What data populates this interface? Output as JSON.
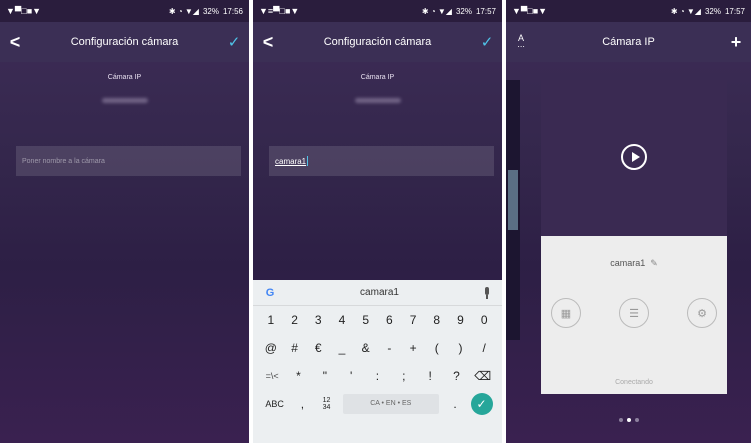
{
  "status_bar": {
    "s1": {
      "icons_left": "▼▀□■▼",
      "battery": "32%",
      "time": "17:56"
    },
    "s2": {
      "icons_left": "▼≡▀□■▼",
      "battery": "32%",
      "time": "17:57"
    },
    "s3": {
      "icons_left": "▼▀□■▼",
      "battery": "32%",
      "time": "17:57"
    }
  },
  "screen1": {
    "title": "Configuración cámara",
    "subtitle": "Cámara IP",
    "input_placeholder": "Poner nombre a la cámara"
  },
  "screen2": {
    "title": "Configuración cámara",
    "subtitle": "Cámara IP",
    "input_value": "camara1",
    "keyboard": {
      "suggestion": "camara1",
      "row1": [
        "1",
        "2",
        "3",
        "4",
        "5",
        "6",
        "7",
        "8",
        "9",
        "0"
      ],
      "row2": [
        "@",
        "#",
        "€",
        "_",
        "&",
        "-",
        "+",
        "(",
        ")",
        "/"
      ],
      "row3": [
        "=\\<",
        "*",
        "\"",
        "'",
        ":",
        ";",
        "!",
        "?",
        "⌫"
      ],
      "abc": "ABC",
      "comma": ",",
      "frac_top": "12",
      "frac_bottom": "34",
      "space_label": "CA • EN • ES",
      "period": "."
    }
  },
  "screen3": {
    "title": "Cámara IP",
    "sort_icon_label": "A",
    "camera_name": "camara1",
    "status": "Conectando"
  },
  "colors": {
    "accent": "#4fc3e8",
    "enter": "#26a69a",
    "background": "#34274c"
  },
  "icons": [
    "back-arrow-icon",
    "check-icon",
    "google-icon",
    "mic-icon",
    "play-icon",
    "pencil-icon",
    "grid-icon",
    "sliders-icon",
    "gear-icon",
    "plus-icon",
    "sort-icon",
    "backspace-icon",
    "enter-icon"
  ]
}
